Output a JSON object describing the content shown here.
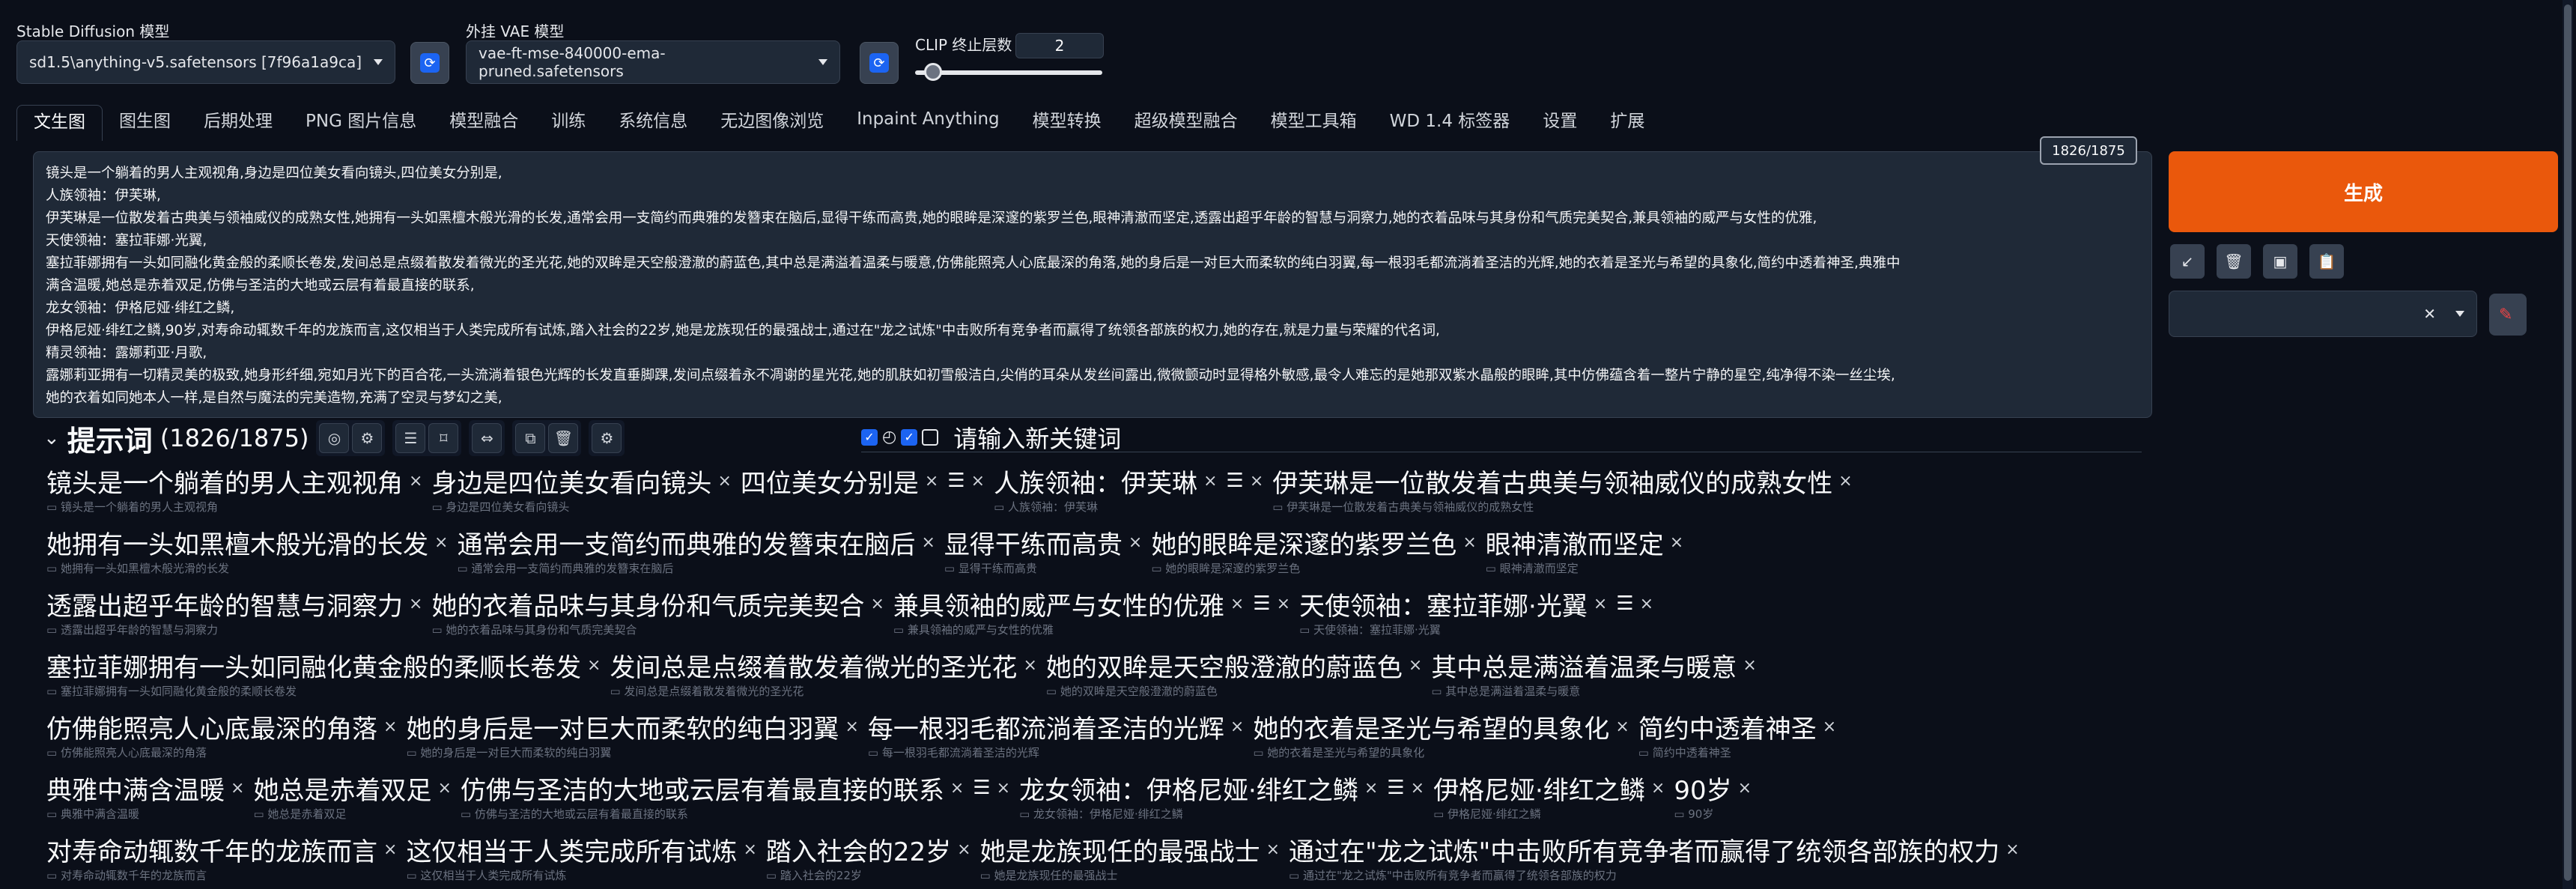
{
  "models": {
    "sd_label": "Stable Diffusion 模型",
    "sd_value": "sd1.5\\anything-v5.safetensors [7f96a1a9ca]",
    "vae_label": "外挂 VAE 模型",
    "vae_value": "vae-ft-mse-840000-ema-pruned.safetensors",
    "clip_label": "CLIP 终止层数",
    "clip_value": "2"
  },
  "tabs": [
    "文生图",
    "图生图",
    "后期处理",
    "PNG 图片信息",
    "模型融合",
    "训练",
    "系统信息",
    "无边图像浏览",
    "Inpaint Anything",
    "模型转换",
    "超级模型融合",
    "模型工具箱",
    "WD 1.4 标签器",
    "设置",
    "扩展"
  ],
  "prompt": {
    "token_counter": "1826/1875",
    "lines": [
      "镜头是一个躺着的男人主观视角,身边是四位美女看向镜头,四位美女分别是,",
      "人族领袖：伊芙琳,",
      "伊芙琳是一位散发着古典美与领袖威仪的成熟女性,她拥有一头如黑檀木般光滑的长发,通常会用一支简约而典雅的发簪束在脑后,显得干练而高贵,她的眼眸是深邃的紫罗兰色,眼神清澈而坚定,透露出超乎年龄的智慧与洞察力,她的衣着品味与其身份和气质完美契合,兼具领袖的威严与女性的优雅,",
      "天使领袖：塞拉菲娜·光翼,",
      "塞拉菲娜拥有一头如同融化黄金般的柔顺长卷发,发间总是点缀着散发着微光的圣光花,她的双眸是天空般澄澈的蔚蓝色,其中总是满溢着温柔与暖意,仿佛能照亮人心底最深的角落,她的身后是一对巨大而柔软的纯白羽翼,每一根羽毛都流淌着圣洁的光辉,她的衣着是圣光与希望的具象化,简约中透着神圣,典雅中",
      "满含温暖,她总是赤着双足,仿佛与圣洁的大地或云层有着最直接的联系,",
      "龙女领袖：伊格尼娅·绯红之鳞,",
      "伊格尼娅·绯红之鳞,90岁,对寿命动辄数千年的龙族而言,这仅相当于人类完成所有试炼,踏入社会的22岁,她是龙族现任的最强战士,通过在\"龙之试炼\"中击败所有竞争者而赢得了统领各部族的权力,她的存在,就是力量与荣耀的代名词,",
      "精灵领袖：露娜莉亚·月歌,",
      "露娜莉亚拥有一切精灵美的极致,她身形纤细,宛如月光下的百合花,一头流淌着银色光辉的长发直垂脚踝,发间点缀着永不凋谢的星光花,她的肌肤如初雪般洁白,尖俏的耳朵从发丝间露出,微微颤动时显得格外敏感,最令人难忘的是她那双紫水晶般的眼眸,其中仿佛蕴含着一整片宁静的星空,纯净得不染一丝尘埃,",
      "她的衣着如同她本人一样,是自然与魔法的完美造物,充满了空灵与梦幻之美,"
    ]
  },
  "generate_label": "生成",
  "tagger": {
    "title": "提示词",
    "count": "(1826/1875)",
    "new_tag_placeholder": "请输入新关键词",
    "rows": [
      [
        {
          "main": "镜头是一个躺着的男人主观视角",
          "sub": "镜头是一个躺着的男人主观视角"
        },
        {
          "main": "身边是四位美女看向镜头",
          "sub": "身边是四位美女看向镜头"
        },
        {
          "main": "四位美女分别是",
          "sub": ""
        },
        {
          "main": "☰",
          "sub": "",
          "spacer": true
        },
        {
          "main": "人族领袖：伊芙琳",
          "sub": "人族领袖：伊芙琳"
        },
        {
          "main": "☰",
          "sub": "",
          "spacer": true
        },
        {
          "main": "伊芙琳是一位散发着古典美与领袖威仪的成熟女性",
          "sub": "伊芙琳是一位散发着古典美与领袖威仪的成熟女性"
        }
      ],
      [
        {
          "main": "她拥有一头如黑檀木般光滑的长发",
          "sub": "她拥有一头如黑檀木般光滑的长发"
        },
        {
          "main": "通常会用一支简约而典雅的发簪束在脑后",
          "sub": "通常会用一支简约而典雅的发簪束在脑后"
        },
        {
          "main": "显得干练而高贵",
          "sub": "显得干练而高贵"
        },
        {
          "main": "她的眼眸是深邃的紫罗兰色",
          "sub": "她的眼眸是深邃的紫罗兰色"
        },
        {
          "main": "眼神清澈而坚定",
          "sub": "眼神清澈而坚定"
        }
      ],
      [
        {
          "main": "透露出超乎年龄的智慧与洞察力",
          "sub": "透露出超乎年龄的智慧与洞察力"
        },
        {
          "main": "她的衣着品味与其身份和气质完美契合",
          "sub": "她的衣着品味与其身份和气质完美契合"
        },
        {
          "main": "兼具领袖的威严与女性的优雅",
          "sub": "兼具领袖的威严与女性的优雅"
        },
        {
          "main": "☰",
          "sub": "",
          "spacer": true
        },
        {
          "main": "天使领袖：塞拉菲娜·光翼",
          "sub": "天使领袖：塞拉菲娜·光翼"
        },
        {
          "main": "☰",
          "sub": "",
          "spacer": true
        }
      ],
      [
        {
          "main": "塞拉菲娜拥有一头如同融化黄金般的柔顺长卷发",
          "sub": "塞拉菲娜拥有一头如同融化黄金般的柔顺长卷发"
        },
        {
          "main": "发间总是点缀着散发着微光的圣光花",
          "sub": "发间总是点缀着散发着微光的圣光花"
        },
        {
          "main": "她的双眸是天空般澄澈的蔚蓝色",
          "sub": "她的双眸是天空般澄澈的蔚蓝色"
        },
        {
          "main": "其中总是满溢着温柔与暖意",
          "sub": "其中总是满溢着温柔与暖意"
        }
      ],
      [
        {
          "main": "仿佛能照亮人心底最深的角落",
          "sub": "仿佛能照亮人心底最深的角落"
        },
        {
          "main": "她的身后是一对巨大而柔软的纯白羽翼",
          "sub": "她的身后是一对巨大而柔软的纯白羽翼"
        },
        {
          "main": "每一根羽毛都流淌着圣洁的光辉",
          "sub": "每一根羽毛都流淌着圣洁的光辉"
        },
        {
          "main": "她的衣着是圣光与希望的具象化",
          "sub": "她的衣着是圣光与希望的具象化"
        },
        {
          "main": "简约中透着神圣",
          "sub": "简约中透着神圣"
        }
      ],
      [
        {
          "main": "典雅中满含温暖",
          "sub": "典雅中满含温暖"
        },
        {
          "main": "她总是赤着双足",
          "sub": "她总是赤着双足"
        },
        {
          "main": "仿佛与圣洁的大地或云层有着最直接的联系",
          "sub": "仿佛与圣洁的大地或云层有着最直接的联系"
        },
        {
          "main": "☰",
          "sub": "",
          "spacer": true
        },
        {
          "main": "龙女领袖：伊格尼娅·绯红之鳞",
          "sub": "龙女领袖：伊格尼娅·绯红之鳞"
        },
        {
          "main": "☰",
          "sub": "",
          "spacer": true
        },
        {
          "main": "伊格尼娅·绯红之鳞",
          "sub": "伊格尼娅·绯红之鳞"
        },
        {
          "main": "90岁",
          "sub": "90岁"
        }
      ],
      [
        {
          "main": "对寿命动辄数千年的龙族而言",
          "sub": "对寿命动辄数千年的龙族而言"
        },
        {
          "main": "这仅相当于人类完成所有试炼",
          "sub": "这仅相当于人类完成所有试炼"
        },
        {
          "main": "踏入社会的22岁",
          "sub": "踏入社会的22岁"
        },
        {
          "main": "她是龙族现任的最强战士",
          "sub": "她是龙族现任的最强战士"
        },
        {
          "main": "通过在\"龙之试炼\"中击败所有竞争者而赢得了统领各部族的权力",
          "sub": "通过在\"龙之试炼\"中击败所有竞争者而赢得了统领各部族的权力"
        }
      ]
    ]
  },
  "colors": {
    "accent": "#ea580c",
    "background": "#0b0f19",
    "checkbox": "#1c64f2"
  }
}
